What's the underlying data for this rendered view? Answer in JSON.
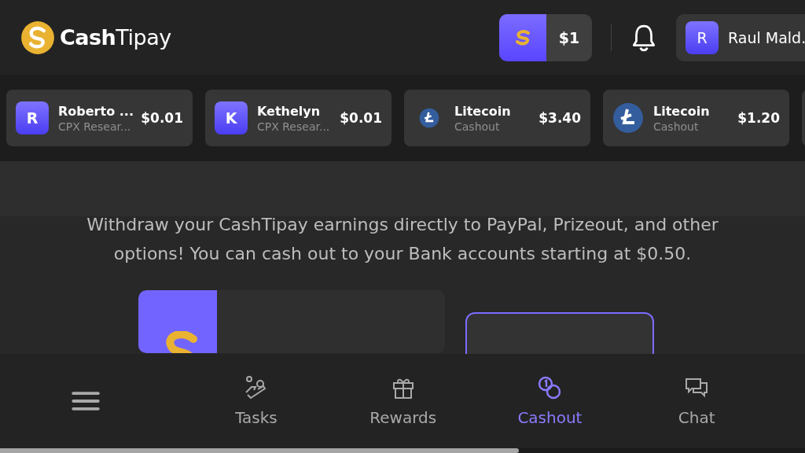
{
  "header": {
    "logo": {
      "brand_bold": "Cash",
      "brand_light": "Tipay"
    },
    "balance": "$1",
    "user": {
      "initial": "R",
      "name": "Raul Mald."
    }
  },
  "ticker": [
    {
      "kind": "letter",
      "initial": "R",
      "name": "Roberto ...",
      "source": "CPX Resear...",
      "amount": "$0.01"
    },
    {
      "kind": "letter",
      "initial": "K",
      "name": "Kethelyn",
      "source": "CPX Resear...",
      "amount": "$0.01"
    },
    {
      "kind": "coin",
      "name": "Litecoin",
      "source": "Cashout",
      "amount": "$3.40"
    },
    {
      "kind": "coin",
      "name": "Litecoin",
      "source": "Cashout",
      "amount": "$1.20"
    }
  ],
  "intro": "Withdraw your CashTipay earnings directly to PayPal, Prizeout, and other options! You can cash out to your Bank accounts starting at $0.50.",
  "nav": [
    {
      "kind": "tasks",
      "label": "Tasks",
      "selected": false
    },
    {
      "kind": "rewards",
      "label": "Rewards",
      "selected": false
    },
    {
      "kind": "cashout",
      "label": "Cashout",
      "selected": true
    },
    {
      "kind": "chat",
      "label": "Chat",
      "selected": false
    }
  ]
}
